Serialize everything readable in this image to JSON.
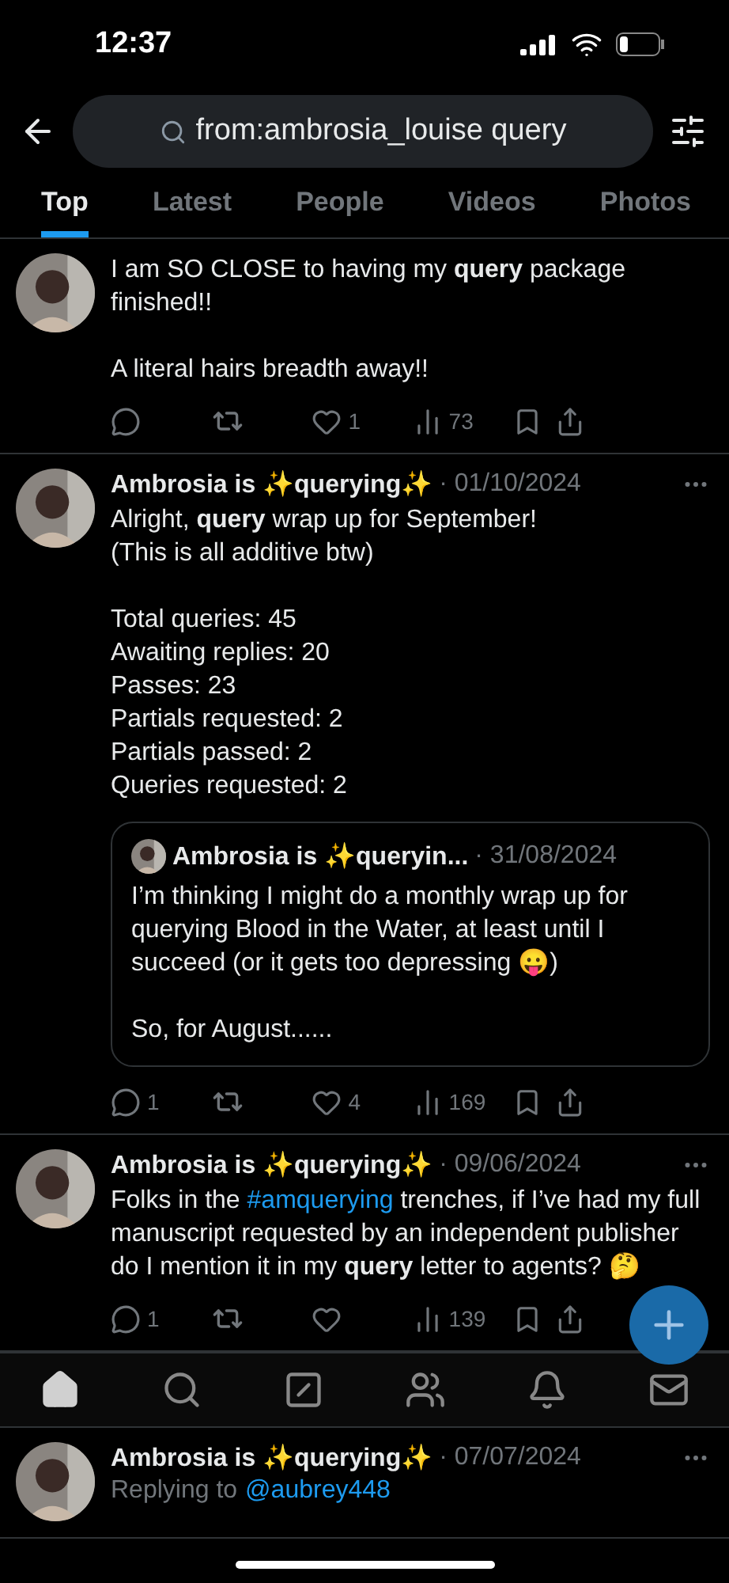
{
  "status_bar": {
    "time": "12:37"
  },
  "search": {
    "value": "from:ambrosia_louise query"
  },
  "tabs": [
    {
      "label": "Top",
      "selected": true
    },
    {
      "label": "Latest",
      "selected": false
    },
    {
      "label": "People",
      "selected": false
    },
    {
      "label": "Videos",
      "selected": false
    },
    {
      "label": "Photos",
      "selected": false
    }
  ],
  "tweets": [
    {
      "body": [
        {
          "kind": "text",
          "text": "I am SO CLOSE to having my **query** package finished!!\n\nA literal hairs breadth away!!"
        }
      ],
      "actions": {
        "likes": "1",
        "views": "73"
      }
    },
    {
      "author": "Ambrosia is ✨querying✨",
      "date": "· 01/10/2024",
      "body": [
        {
          "kind": "text",
          "text": "Alright, **query** wrap up for September!\n(This is all additive btw)\n\nTotal queries: 45\nAwaiting replies: 20\nPasses: 23\nPartials requested: 2\nPartials passed: 2\nQueries requested: 2"
        }
      ],
      "quote": {
        "author": "Ambrosia is ✨queryin...",
        "date": "· 31/08/2024",
        "text": "I’m thinking I might do a monthly wrap up for querying Blood in the Water, at least until I succeed (or it gets too depressing 😛)\n\nSo, for August......"
      },
      "actions": {
        "replies": "1",
        "likes": "4",
        "views": "169"
      }
    },
    {
      "author": "Ambrosia is ✨querying✨",
      "date": "· 09/06/2024",
      "body": [
        {
          "kind": "text",
          "text": "Folks in the "
        },
        {
          "kind": "hashtag",
          "text": "#amquerying"
        },
        {
          "kind": "text",
          "text": " trenches, if I’ve had my full manuscript requested by an independent publisher do I mention it in my **query** letter to agents? 🤔"
        }
      ],
      "actions": {
        "replies": "1",
        "views": "139"
      }
    },
    {
      "author": "Ambrosia is ✨querying✨",
      "date": "· 07/07/2024",
      "replying_label": "Replying to",
      "replying_to": "@aubrey448"
    }
  ],
  "nav": [
    {
      "kind": "home",
      "selected": true
    },
    {
      "kind": "search",
      "selected": false
    },
    {
      "kind": "compose",
      "selected": false
    },
    {
      "kind": "people",
      "selected": false
    },
    {
      "kind": "bell",
      "selected": false
    },
    {
      "kind": "mail",
      "selected": false
    }
  ]
}
